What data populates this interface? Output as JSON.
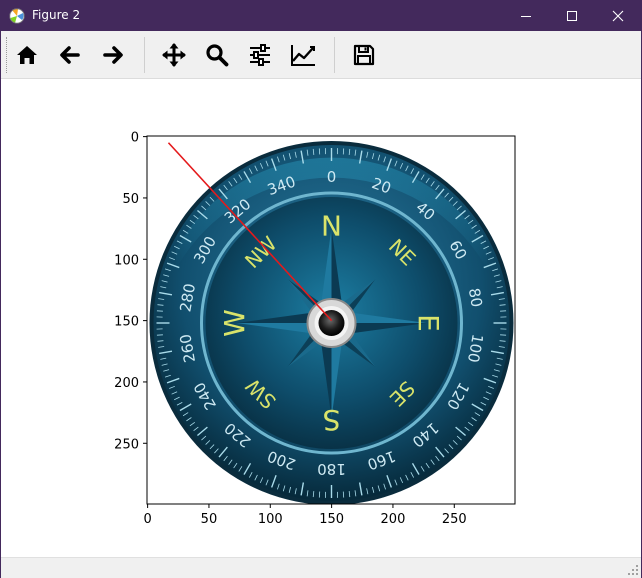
{
  "window": {
    "title": "Figure 2",
    "controls": {
      "minimize": "minimize",
      "maximize": "maximize",
      "close": "close"
    }
  },
  "toolbar": {
    "buttons": [
      {
        "name": "home",
        "icon": "home-icon"
      },
      {
        "name": "back",
        "icon": "arrow-left-icon"
      },
      {
        "name": "forward",
        "icon": "arrow-right-icon"
      },
      {
        "name": "pan",
        "icon": "move-icon"
      },
      {
        "name": "zoom",
        "icon": "magnifier-icon"
      },
      {
        "name": "subplots",
        "icon": "sliders-icon"
      },
      {
        "name": "edit-axes",
        "icon": "line-chart-icon"
      },
      {
        "name": "save",
        "icon": "floppy-disk-icon"
      }
    ]
  },
  "plot": {
    "x_ticks": [
      "0",
      "50",
      "100",
      "150",
      "200",
      "250"
    ],
    "y_ticks": [
      "0",
      "50",
      "100",
      "150",
      "200",
      "250"
    ],
    "xlim": [
      0,
      299
    ],
    "ylim": [
      299,
      0
    ],
    "line": {
      "x": [
        17,
        150
      ],
      "y": [
        5,
        150
      ],
      "color": "#e41a1c"
    },
    "image": {
      "description_icon": "compass-image",
      "cardinals": [
        "N",
        "E",
        "S",
        "W"
      ],
      "intercardinals": [
        "NE",
        "SE",
        "SW",
        "NW"
      ],
      "degree_labels": [
        "0",
        "20",
        "40",
        "60",
        "80",
        "100",
        "120",
        "140",
        "160",
        "180",
        "200",
        "220",
        "240",
        "260",
        "280",
        "300",
        "320",
        "340"
      ]
    }
  },
  "status": {
    "text": ""
  },
  "colors": {
    "titlebar": "#43295c",
    "line": "#e41a1c",
    "dial_text": "#d9e36a"
  }
}
